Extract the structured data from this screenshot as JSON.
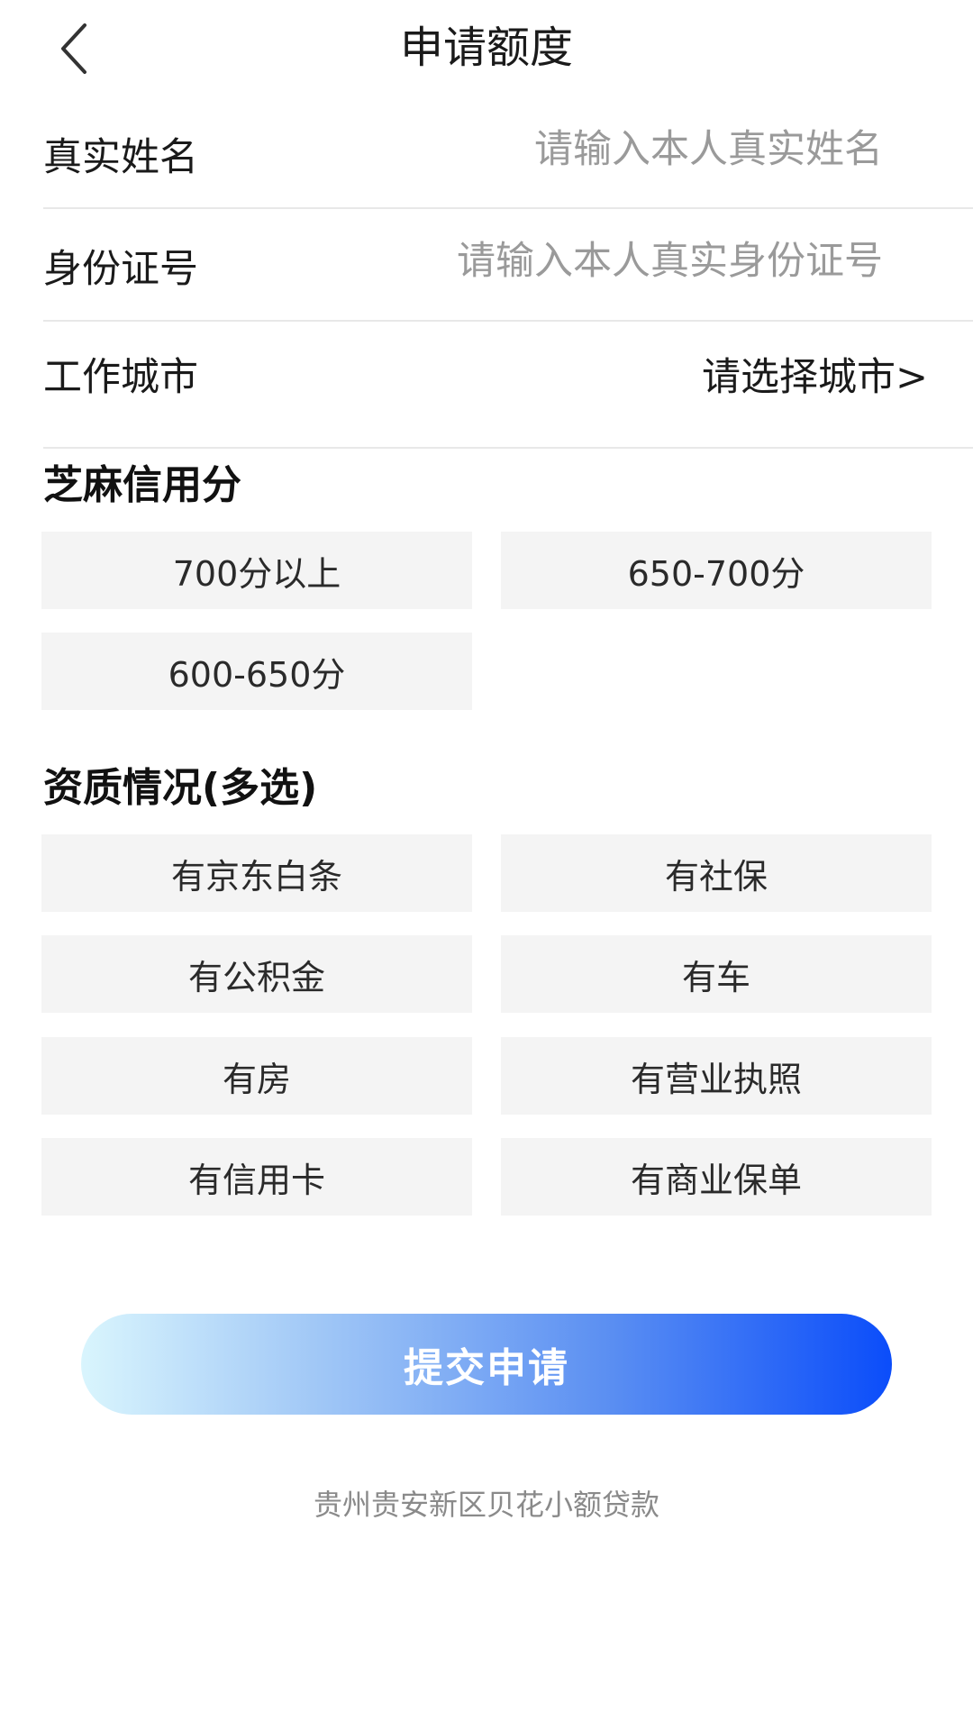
{
  "header": {
    "title": "申请额度",
    "back_icon": "chevron-left-icon"
  },
  "form": {
    "name": {
      "label": "真实姓名",
      "placeholder": "请输入本人真实姓名",
      "value": ""
    },
    "id_number": {
      "label": "身份证号",
      "placeholder": "请输入本人真实身份证号",
      "value": ""
    },
    "city": {
      "label": "工作城市",
      "select_text": "请选择城市>"
    }
  },
  "credit_score": {
    "title": "芝麻信用分",
    "options": [
      "700分以上",
      "650-700分",
      "600-650分"
    ]
  },
  "qualifications": {
    "title": "资质情况(多选)",
    "options": [
      "有京东白条",
      "有社保",
      "有公积金",
      "有车",
      "有房",
      "有营业执照",
      "有信用卡",
      "有商业保单"
    ]
  },
  "submit": {
    "label": "提交申请"
  },
  "footer": {
    "text": "贵州贵安新区贝花小额贷款"
  },
  "colors": {
    "accent_gradient_start": "#d9f5fd",
    "accent_gradient_end": "#0b4dfa",
    "option_background": "#f4f4f4"
  }
}
